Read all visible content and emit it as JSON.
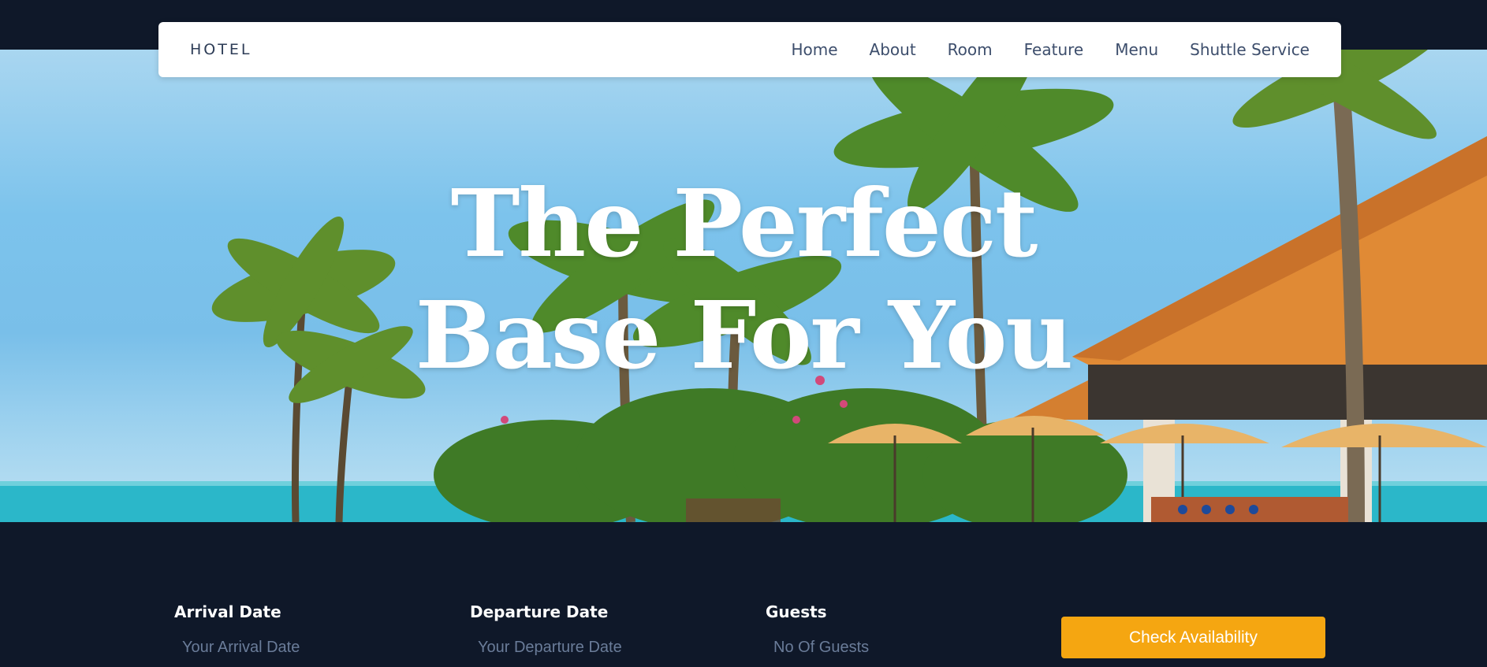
{
  "brand": "HOTEL",
  "nav": {
    "items": [
      "Home",
      "About",
      "Room",
      "Feature",
      "Menu",
      "Shuttle Service"
    ]
  },
  "hero": {
    "title_line1": "The Perfect",
    "title_line2": "Base For You"
  },
  "booking": {
    "arrival": {
      "label": "Arrival Date",
      "placeholder": "Your Arrival Date"
    },
    "departure": {
      "label": "Departure Date",
      "placeholder": "Your Departure Date"
    },
    "guests": {
      "label": "Guests",
      "placeholder": "No Of Guests"
    },
    "button_label": "Check Availability"
  },
  "colors": {
    "page_background": "#0f1829",
    "accent_button": "#f5a611",
    "nav_text": "#3d4e6c"
  }
}
